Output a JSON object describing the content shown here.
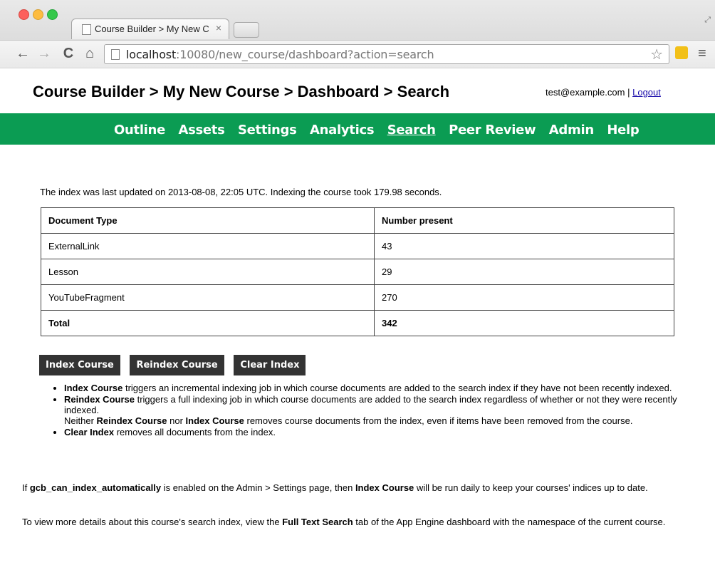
{
  "browser": {
    "tab_title": "Course Builder > My New C",
    "tab_close": "×",
    "url_host": "localhost",
    "url_rest": ":10080/new_course/dashboard?action=search"
  },
  "header": {
    "title": "Course Builder > My New Course > Dashboard > Search",
    "user_email": "test@example.com",
    "separator": "|",
    "logout_label": "Logout"
  },
  "nav": {
    "items": [
      {
        "label": "Outline"
      },
      {
        "label": "Assets"
      },
      {
        "label": "Settings"
      },
      {
        "label": "Analytics"
      },
      {
        "label": "Search"
      },
      {
        "label": "Peer Review"
      },
      {
        "label": "Admin"
      },
      {
        "label": "Help"
      }
    ],
    "active": "Search"
  },
  "main": {
    "summary": "The index was last updated on 2013-08-08, 22:05 UTC. Indexing the course took 179.98 seconds.",
    "table": {
      "headers": [
        "Document Type",
        "Number present"
      ],
      "rows": [
        [
          "ExternalLink",
          "43"
        ],
        [
          "Lesson",
          "29"
        ],
        [
          "YouTubeFragment",
          "270"
        ]
      ],
      "total": [
        "Total",
        "342"
      ]
    },
    "buttons": {
      "index": "Index Course",
      "reindex": "Reindex Course",
      "clear": "Clear Index"
    },
    "help": {
      "item1_bold": "Index Course",
      "item1_text": " triggers an incremental indexing job in which course documents are added to the search index if they have not been recently indexed.",
      "item2_bold": "Reindex Course",
      "item2_text": " triggers a full indexing job in which course documents are added to the search index regardless of whether or not they were recently indexed.",
      "item2_neither": "Neither ",
      "item2_bold2": "Reindex Course",
      "item2_nor": " nor ",
      "item2_bold3": "Index Course",
      "item2_text2": " removes course documents from the index, even if items have been removed from the course.",
      "item3_bold": "Clear Index",
      "item3_text": " removes all documents from the index."
    },
    "note1": {
      "prefix": "If ",
      "setting": "gcb_can_index_automatically",
      "middle": " is enabled on the Admin > Settings page, then ",
      "bold": "Index Course",
      "suffix": " will be run daily to keep your courses' indices up to date."
    },
    "note2": {
      "prefix": "To view more details about this course's search index, view the ",
      "bold": "Full Text Search",
      "suffix": " tab of the App Engine dashboard with the namespace of the current course."
    }
  }
}
